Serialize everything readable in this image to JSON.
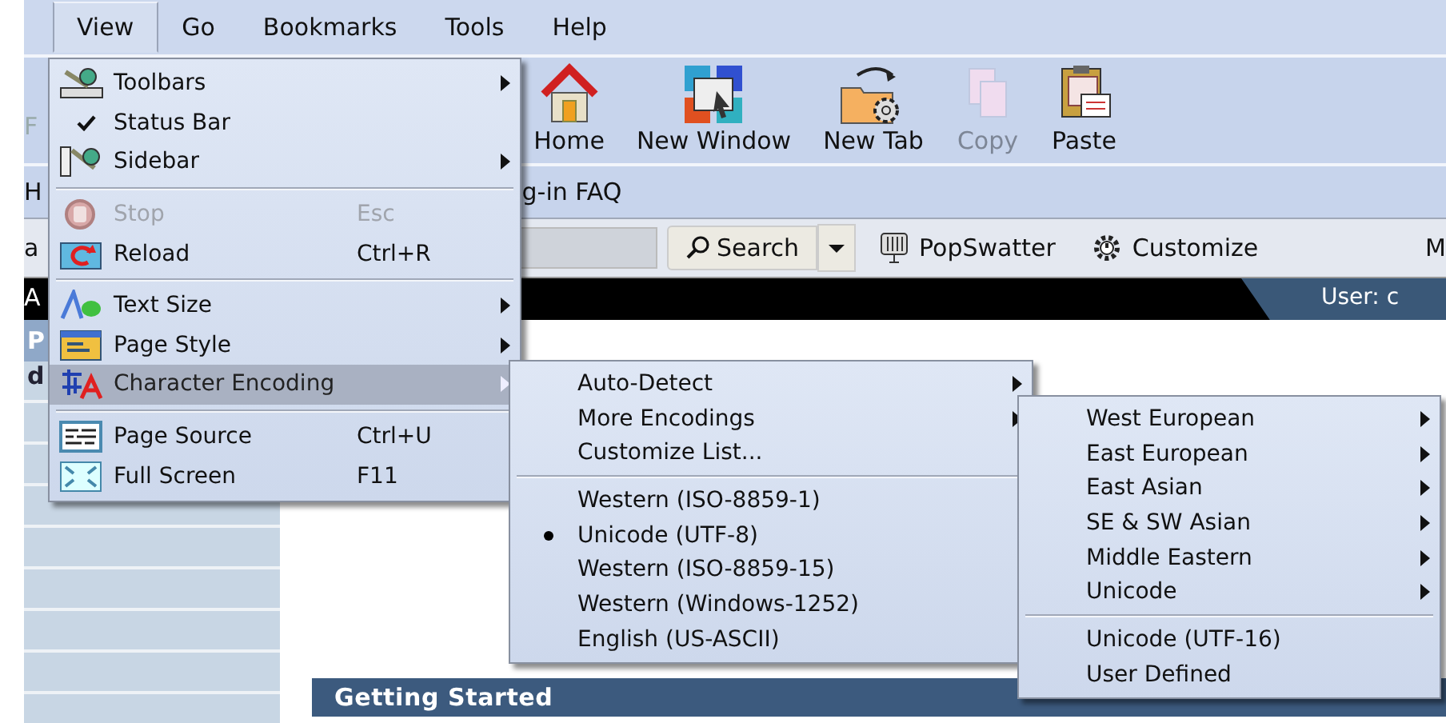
{
  "menubar": [
    {
      "label": "View",
      "selected": true
    },
    {
      "label": "Go",
      "selected": false
    },
    {
      "label": "Bookmarks",
      "selected": false
    },
    {
      "label": "Tools",
      "selected": false
    },
    {
      "label": "Help",
      "selected": false
    }
  ],
  "toolbar": {
    "fragment_left": "F",
    "buttons": [
      {
        "label": "Home",
        "kind": "home",
        "disabled": false
      },
      {
        "label": "New Window",
        "kind": "window",
        "disabled": false
      },
      {
        "label": "New Tab",
        "kind": "tab",
        "disabled": false
      },
      {
        "label": "Copy",
        "kind": "copy",
        "disabled": true
      },
      {
        "label": "Paste",
        "kind": "paste",
        "disabled": false
      }
    ]
  },
  "bookmarks_bar": {
    "fragment_left": "H",
    "link": "g-in FAQ"
  },
  "search_toolbar": {
    "fragment_left": "a",
    "search_button": "Search",
    "items": [
      {
        "label": "PopSwatter",
        "kind": "swatter"
      },
      {
        "label": "Customize",
        "kind": "gear"
      }
    ],
    "fragment_right": "M"
  },
  "banner": {
    "fragment_left": "A",
    "user": "User: c"
  },
  "sidebar": {
    "header": "P",
    "row": "d"
  },
  "content": {
    "section_title": "Getting Started"
  },
  "view_menu": [
    {
      "kind": "item",
      "label": "Toolbars",
      "submenu": true,
      "checked": false,
      "disabled": false,
      "selected": false
    },
    {
      "kind": "item",
      "label": "Status Bar",
      "submenu": false,
      "checked": true,
      "disabled": false,
      "selected": false
    },
    {
      "kind": "item",
      "label": "Sidebar",
      "submenu": true,
      "checked": false,
      "disabled": false,
      "selected": false
    },
    {
      "kind": "separator"
    },
    {
      "kind": "item",
      "label": "Stop",
      "shortcut": "Esc",
      "submenu": false,
      "checked": false,
      "disabled": true,
      "selected": false
    },
    {
      "kind": "item",
      "label": "Reload",
      "shortcut": "Ctrl+R",
      "submenu": false,
      "checked": false,
      "disabled": false,
      "selected": false
    },
    {
      "kind": "separator"
    },
    {
      "kind": "item",
      "label": "Text Size",
      "submenu": true,
      "checked": false,
      "disabled": false,
      "selected": false
    },
    {
      "kind": "item",
      "label": "Page Style",
      "submenu": true,
      "checked": false,
      "disabled": false,
      "selected": false
    },
    {
      "kind": "item",
      "label": "Character Encoding",
      "submenu": true,
      "checked": false,
      "disabled": false,
      "selected": true
    },
    {
      "kind": "separator"
    },
    {
      "kind": "item",
      "label": "Page Source",
      "shortcut": "Ctrl+U",
      "submenu": false,
      "checked": false,
      "disabled": false,
      "selected": false
    },
    {
      "kind": "item",
      "label": "Full Screen",
      "shortcut": "F11",
      "submenu": false,
      "checked": false,
      "disabled": false,
      "selected": false
    }
  ],
  "encoding_menu": [
    {
      "kind": "item",
      "label": "Auto-Detect",
      "submenu": true,
      "checked": false
    },
    {
      "kind": "item",
      "label": "More Encodings",
      "submenu": true,
      "checked": false
    },
    {
      "kind": "item",
      "label": "Customize List...",
      "submenu": false,
      "checked": false
    },
    {
      "kind": "separator"
    },
    {
      "kind": "item",
      "label": "Western (ISO-8859-1)",
      "submenu": false,
      "checked": false
    },
    {
      "kind": "item",
      "label": "Unicode (UTF-8)",
      "submenu": false,
      "checked": true
    },
    {
      "kind": "item",
      "label": "Western (ISO-8859-15)",
      "submenu": false,
      "checked": false
    },
    {
      "kind": "item",
      "label": "Western (Windows-1252)",
      "submenu": false,
      "checked": false
    },
    {
      "kind": "item",
      "label": "English (US-ASCII)",
      "submenu": false,
      "checked": false
    }
  ],
  "more_encodings_menu": [
    {
      "kind": "item",
      "label": "West European",
      "submenu": true
    },
    {
      "kind": "item",
      "label": "East European",
      "submenu": true
    },
    {
      "kind": "item",
      "label": "East Asian",
      "submenu": true
    },
    {
      "kind": "item",
      "label": "SE & SW Asian",
      "submenu": true
    },
    {
      "kind": "item",
      "label": "Middle Eastern",
      "submenu": true
    },
    {
      "kind": "item",
      "label": "Unicode",
      "submenu": true
    },
    {
      "kind": "separator"
    },
    {
      "kind": "item",
      "label": "Unicode (UTF-16)",
      "submenu": false
    },
    {
      "kind": "item",
      "label": "User Defined",
      "submenu": false
    }
  ]
}
